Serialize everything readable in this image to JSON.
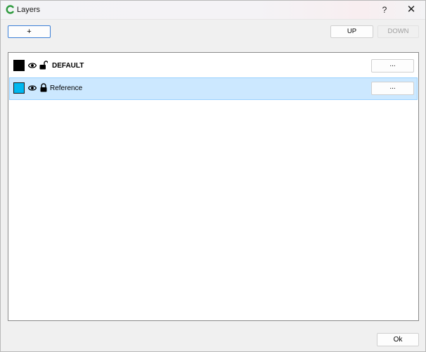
{
  "window": {
    "title": "Layers",
    "help_label": "?",
    "close_label": "✕"
  },
  "toolbar": {
    "add_label": "+",
    "up_label": "UP",
    "down_label": "DOWN"
  },
  "layers": [
    {
      "name": "DEFAULT",
      "color": "#000000",
      "visible": true,
      "locked": false,
      "more_label": "...",
      "selected": false
    },
    {
      "name": "Reference",
      "color": "#00b8f0",
      "visible": true,
      "locked": true,
      "more_label": "...",
      "selected": true
    }
  ],
  "footer": {
    "ok_label": "Ok"
  },
  "icons": {
    "app": "app-logo-icon",
    "visibility": "eye-icon",
    "unlocked": "unlocked-icon",
    "locked": "lock-icon"
  }
}
